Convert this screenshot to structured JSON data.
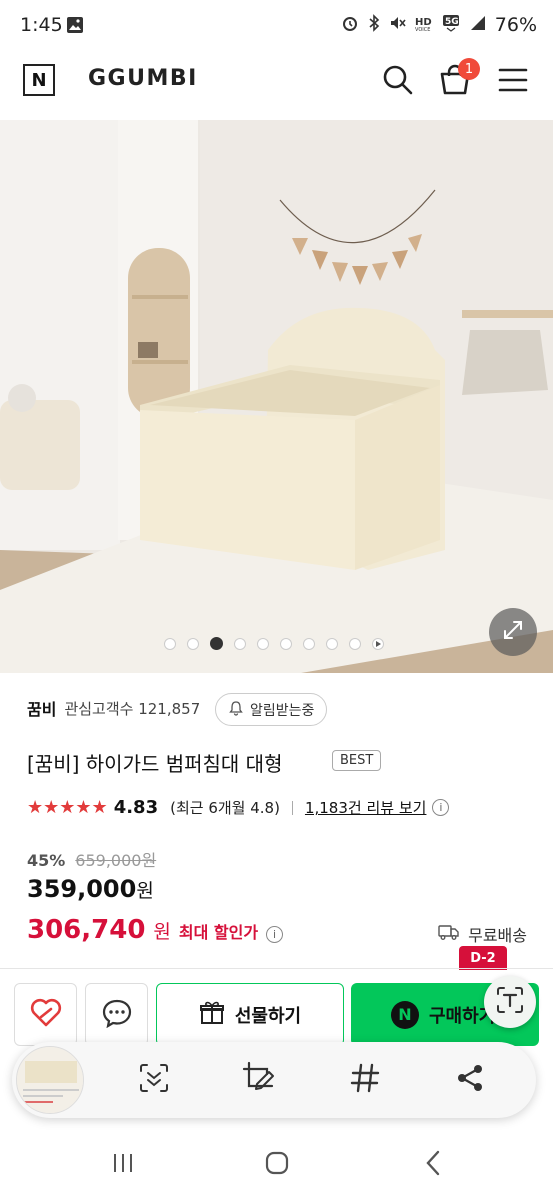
{
  "status_bar": {
    "time": "1:45",
    "battery": "76%",
    "icons": [
      "image-icon",
      "alarm-icon",
      "bluetooth-icon",
      "mute-icon",
      "hd-voice-icon",
      "5g-signal-icon",
      "signal-icon",
      "battery-icon"
    ]
  },
  "header": {
    "logo_letter": "N",
    "brand": "GGUMBI",
    "cart_count": "1"
  },
  "hero": {
    "dot_count": 9,
    "active_dot_index": 2
  },
  "product": {
    "seller": "꿈비",
    "interest_label": "관심고객수 121,857",
    "alarm_label": "알림받는중",
    "title": "[꿈비] 하이가드 범퍼침대 대형",
    "badge": "BEST",
    "stars": "★★★★★",
    "rating": "4.83",
    "rating_recent": "(최근 6개월 4.8)",
    "review_link": "1,183건 리뷰 보기",
    "discount_rate": "45%",
    "original_price": "659,000원",
    "sale_price": "359,000",
    "sale_unit": "원",
    "max_price": "306,740",
    "max_unit": "원",
    "max_label": "최대 할인가",
    "shipping": "무료배송",
    "d_badge": "D-2"
  },
  "actions": {
    "gift_label": "선물하기",
    "buy_label": "구매하기",
    "naver_letter": "N"
  },
  "colors": {
    "naver_green": "#03c75a",
    "price_red": "#d6103a",
    "star_red": "#e23b3b",
    "badge_red": "#f04a3a"
  }
}
